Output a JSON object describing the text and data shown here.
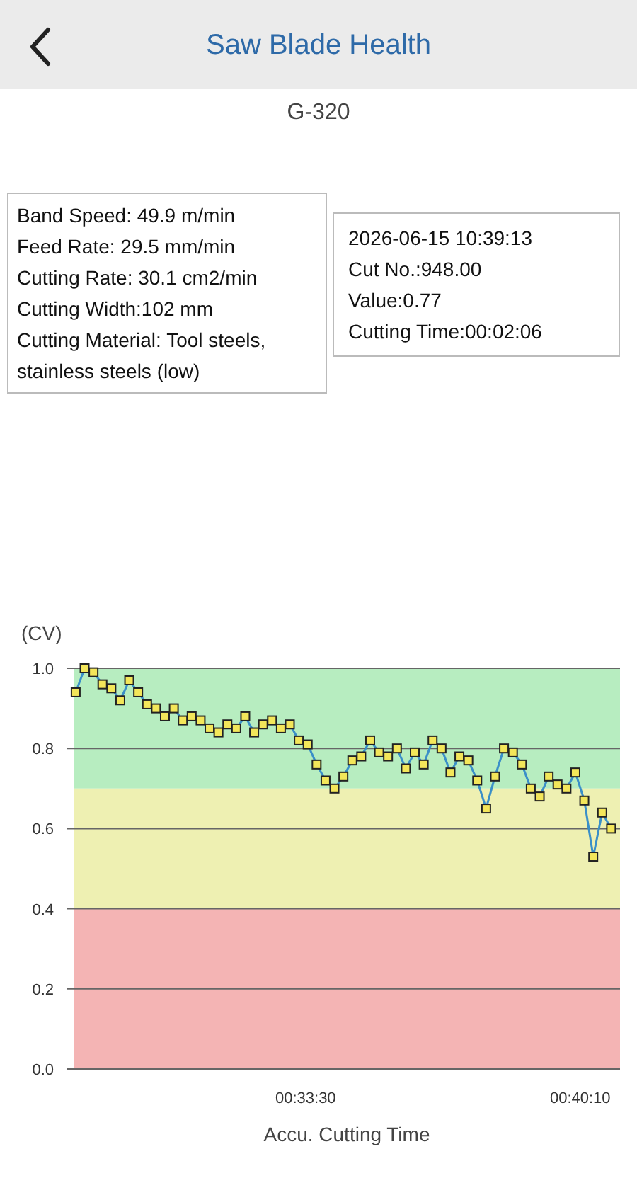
{
  "header": {
    "title": "Saw Blade Health"
  },
  "machine": "G-320",
  "settings": [
    "Band Speed: 49.9 m/min",
    "Feed Rate: 29.5 mm/min",
    "Cutting Rate: 30.1 cm2/min",
    "Cutting Width:102 mm",
    "Cutting Material: Tool steels, stainless steels (low)"
  ],
  "selection": [
    "2026-06-15 10:39:13",
    "Cut No.:948.00",
    "Value:0.77",
    "Cutting Time:00:02:06"
  ],
  "chart": {
    "chart_data": {
      "type": "line",
      "ylabel": "(CV)",
      "xlabel": "Accu. Cutting Time",
      "x": [
        1675,
        1688,
        1701,
        1714,
        1727,
        1740,
        1753,
        1766,
        1779,
        1792,
        1805,
        1818,
        1831,
        1844,
        1857,
        1870,
        1883,
        1896,
        1909,
        1922,
        1935,
        1948,
        1961,
        1974,
        1987,
        2000,
        2013,
        2026,
        2039,
        2052,
        2065,
        2078,
        2091,
        2104,
        2117,
        2130,
        2143,
        2156,
        2169,
        2182,
        2195,
        2208,
        2221,
        2234,
        2247,
        2260,
        2273,
        2286,
        2299,
        2312,
        2325,
        2338,
        2351,
        2364,
        2377,
        2390,
        2403,
        2416,
        2429,
        2442,
        2455
      ],
      "grid": true,
      "series": [
        {
          "color": "#3a8fc8",
          "marker": "square",
          "values": [
            0.94,
            1.0,
            0.99,
            0.96,
            0.95,
            0.92,
            0.97,
            0.94,
            0.91,
            0.9,
            0.88,
            0.9,
            0.87,
            0.88,
            0.87,
            0.85,
            0.84,
            0.86,
            0.85,
            0.88,
            0.84,
            0.86,
            0.87,
            0.85,
            0.86,
            0.82,
            0.81,
            0.76,
            0.72,
            0.7,
            0.73,
            0.77,
            0.78,
            0.82,
            0.79,
            0.78,
            0.8,
            0.75,
            0.79,
            0.76,
            0.82,
            0.8,
            0.74,
            0.78,
            0.77,
            0.72,
            0.65,
            0.73,
            0.8,
            0.79,
            0.76,
            0.7,
            0.68,
            0.73,
            0.71,
            0.7,
            0.74,
            0.67,
            0.53,
            0.64,
            0.6
          ]
        }
      ],
      "xlim": [
        1672,
        2468
      ],
      "ylim": [
        0,
        1
      ],
      "xticks": [
        {
          "value": 2010,
          "label": "00:33:30"
        },
        {
          "value": 2410,
          "label": "00:40:10"
        }
      ],
      "yticks": [
        {
          "value": 0,
          "label": "0.0"
        },
        {
          "value": 0.2,
          "label": "0.2"
        },
        {
          "value": 0.4,
          "label": "0.4"
        },
        {
          "value": 0.6,
          "label": "0.6"
        },
        {
          "value": 0.8,
          "label": "0.8"
        },
        {
          "value": 1,
          "label": "1.0"
        }
      ],
      "bands": [
        {
          "axis": "y",
          "from": 0.7,
          "to": 1.0,
          "color": "#b7edc0"
        },
        {
          "axis": "y",
          "from": 0.4,
          "to": 0.7,
          "color": "#eef0b2"
        },
        {
          "axis": "y",
          "from": 0,
          "to": 0.4,
          "color": "#f4b4b4"
        }
      ]
    }
  }
}
